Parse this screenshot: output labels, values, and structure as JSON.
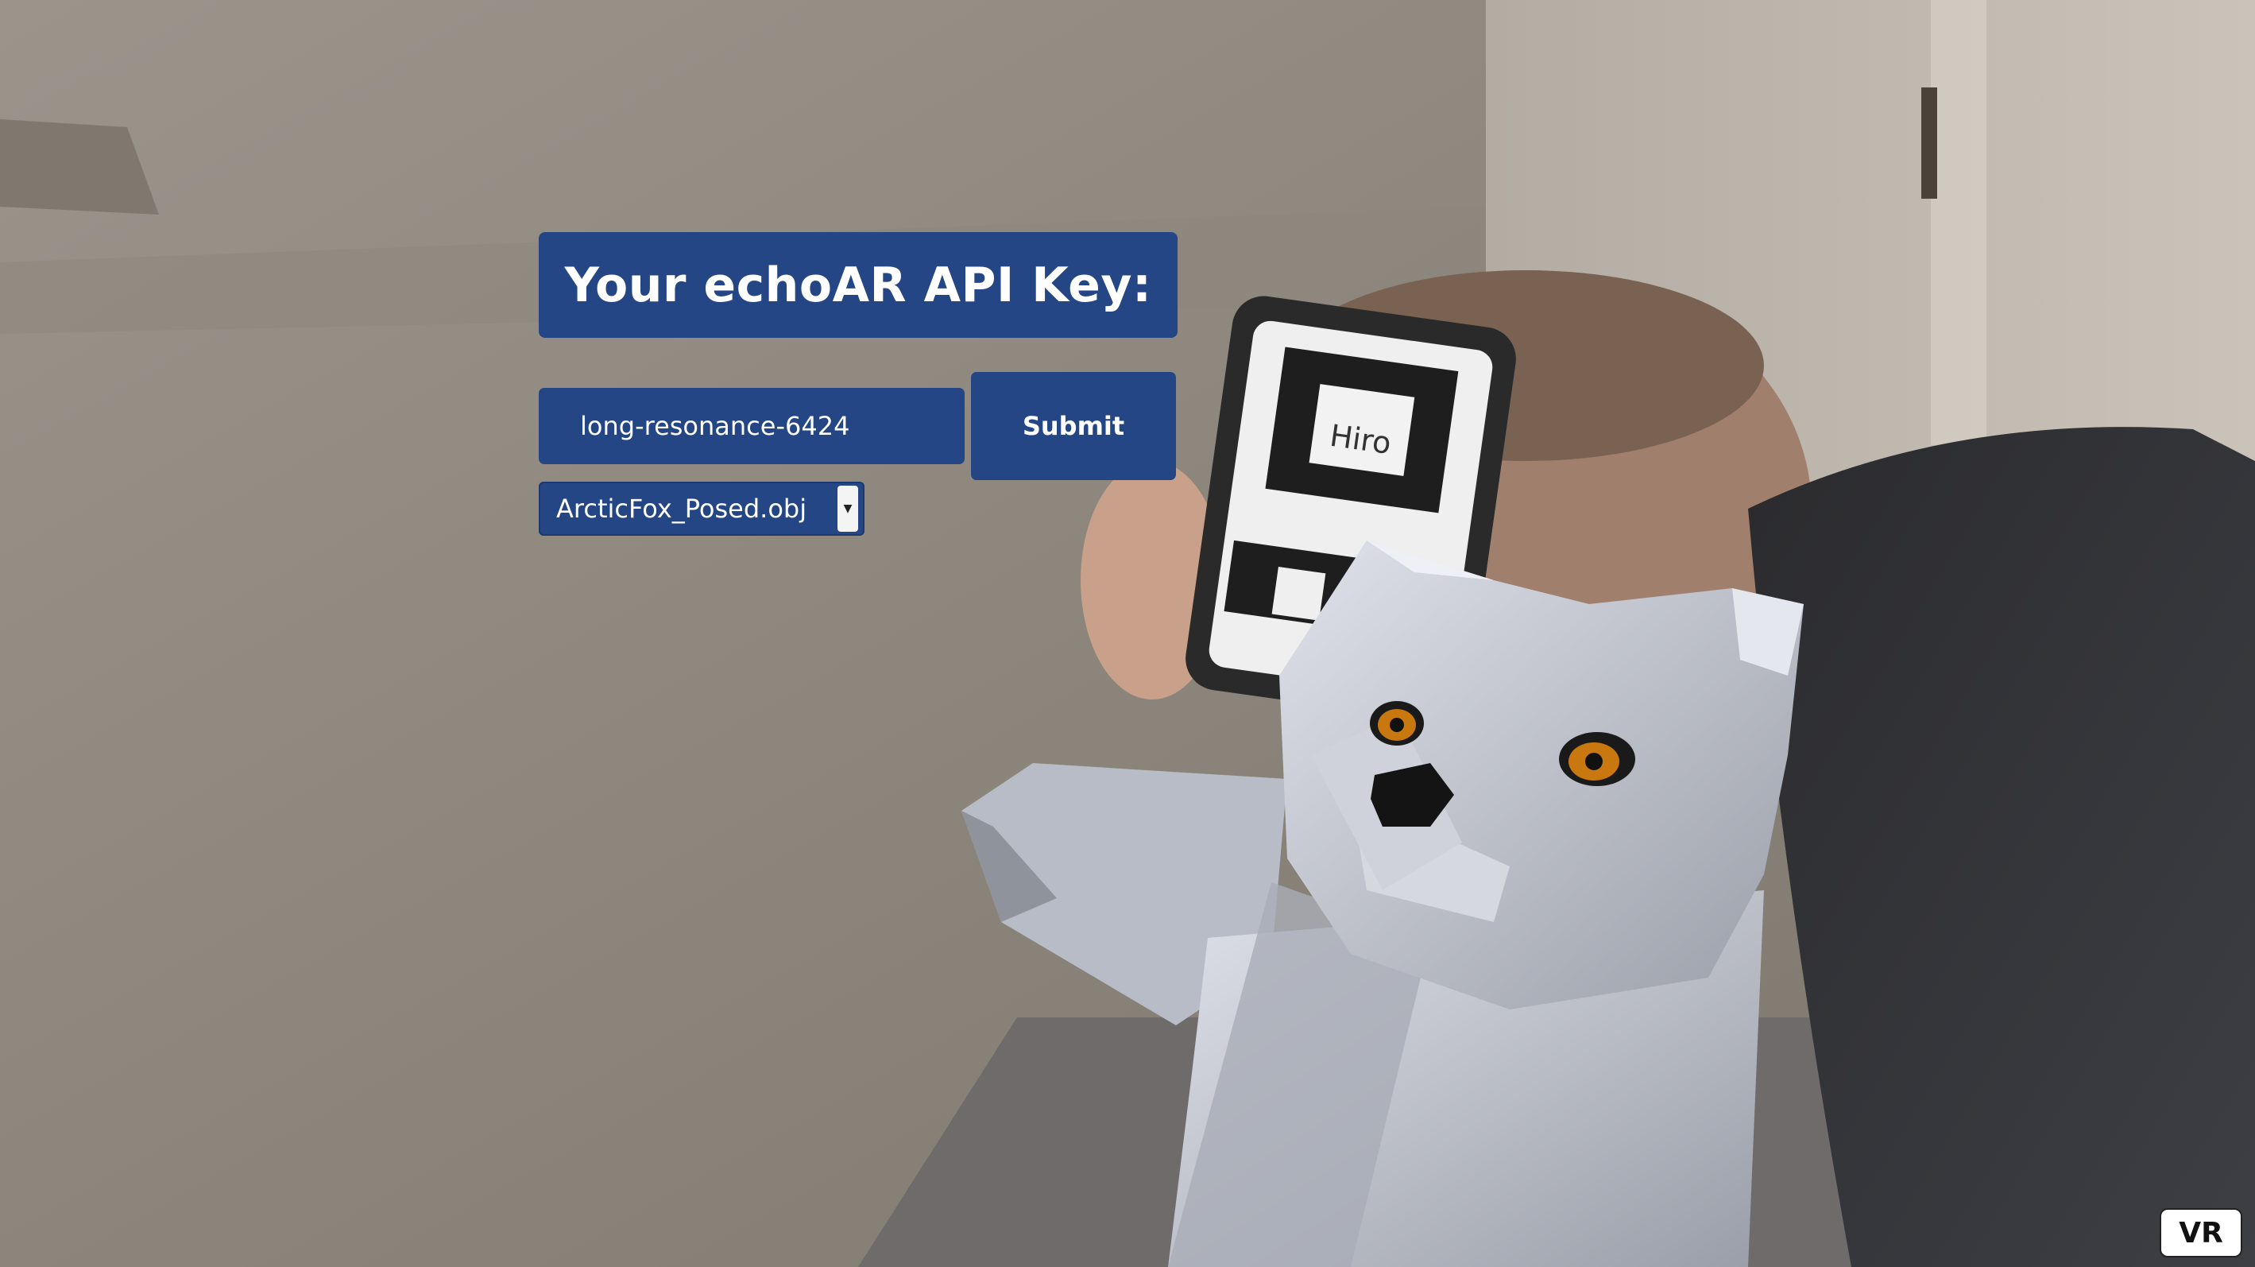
{
  "header": {
    "title": "Your echoAR API Key:"
  },
  "api_key_input": {
    "value": "long-resonance-6424"
  },
  "submit": {
    "label": "Submit"
  },
  "model_select": {
    "selected": "ArcticFox_Posed.obj"
  },
  "vr": {
    "label": "VR"
  },
  "marker": {
    "label": "Hiro"
  },
  "icons": {
    "select_arrow": "chevron-down-icon"
  },
  "colors": {
    "ui_panel": "#244684",
    "ui_text": "#ffffff"
  }
}
